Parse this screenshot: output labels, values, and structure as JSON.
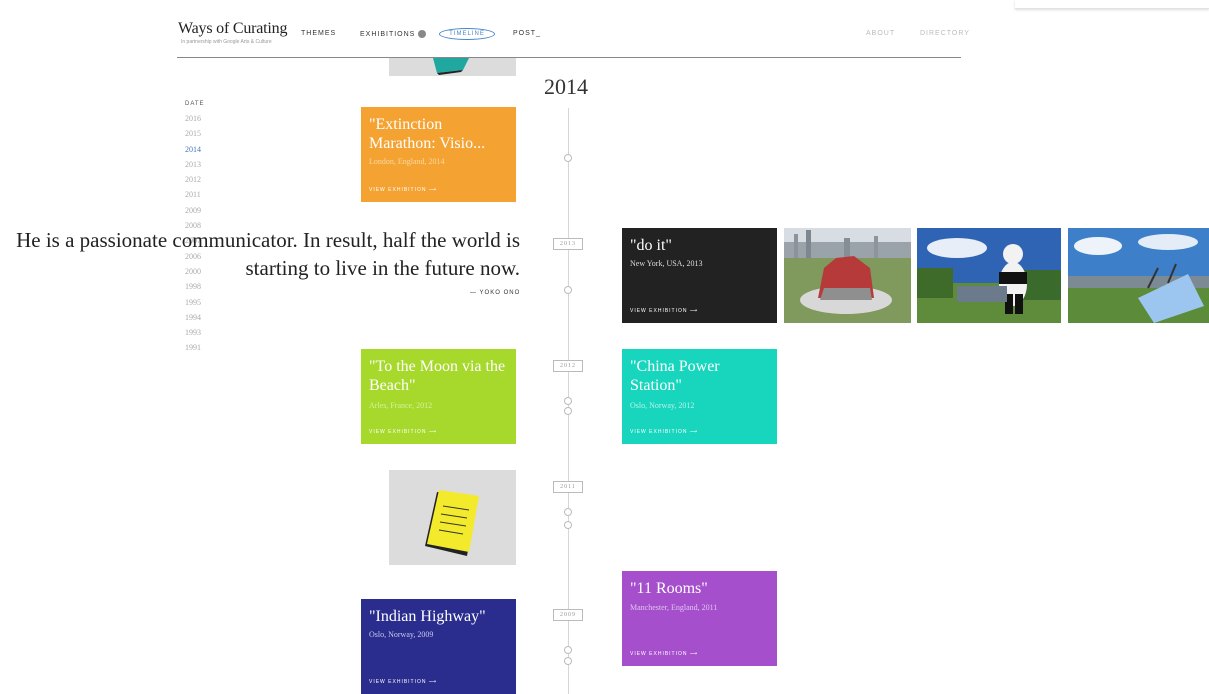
{
  "header": {
    "logo": "Ways of Curating",
    "logo_sub": "In partnership with Google Arts & Culture",
    "nav": {
      "themes": "THEMES",
      "exhibitions": "EXHIBITIONS",
      "timeline": "TIMELINE",
      "post": "POST_",
      "about": "ABOUT",
      "directory": "DIRECTORY"
    }
  },
  "current_year": "2014",
  "sidebar": {
    "header": "DATE",
    "years": [
      "2016",
      "2015",
      "2014",
      "2013",
      "2012",
      "2011",
      "2009",
      "2008",
      "2007",
      "2006",
      "2000",
      "1998",
      "1995",
      "1994",
      "1993",
      "1991"
    ],
    "active": "2014"
  },
  "timeline_labels": [
    "2013",
    "2012",
    "2011",
    "2009"
  ],
  "cards": {
    "extinction": {
      "title": "\"Extinction Marathon: Visio...",
      "location": "London, England",
      "year": "2014",
      "cta": "VIEW EXHIBITION ⟶",
      "color": "#f4a332"
    },
    "doit": {
      "title": "\"do it\"",
      "location": "New York, USA",
      "year": "2013",
      "cta": "VIEW EXHIBITION ⟶",
      "color": "#222222"
    },
    "moon": {
      "title": "\"To the Moon via the Beach\"",
      "location": "Arles, France",
      "year": "2012",
      "cta": "VIEW EXHIBITION ⟶",
      "color": "#a6d92b"
    },
    "china": {
      "title": "\"China Power Station\"",
      "location": "Oslo, Norway",
      "year": "2012",
      "cta": "VIEW EXHIBITION ⟶",
      "color": "#17d6bd"
    },
    "rooms": {
      "title": "\"11 Rooms\"",
      "location": "Manchester, England",
      "year": "2011",
      "cta": "VIEW EXHIBITION ⟶",
      "color": "#a54fcc"
    },
    "highway": {
      "title": "\"Indian Highway\"",
      "location": "Oslo, Norway",
      "year": "2009",
      "cta": "VIEW EXHIBITION ⟶",
      "color": "#2b2d8e"
    }
  },
  "quote": {
    "text": "He is a passionate communicator. In result, half the world is starting to live in the future now.",
    "attribution": "— YOKO ONO"
  }
}
